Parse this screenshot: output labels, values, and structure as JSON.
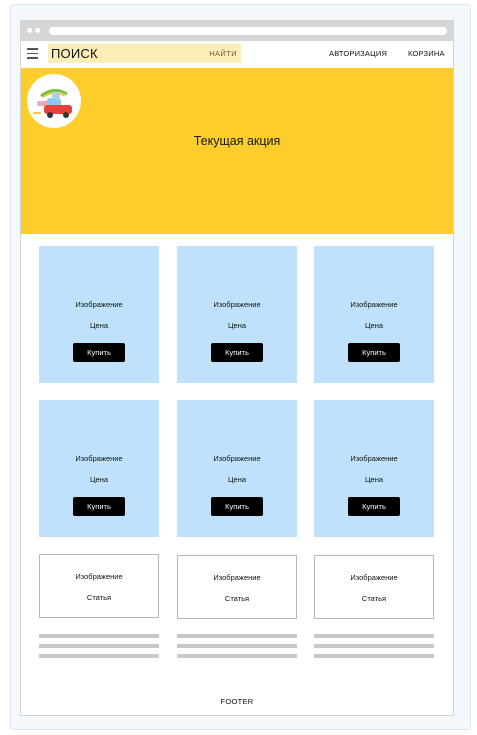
{
  "header": {
    "search_label": "ПОИСК",
    "search_button": "НАЙТИ",
    "nav_auth": "АВТОРИЗАЦИЯ",
    "nav_cart": "КОРЗИНА"
  },
  "banner": {
    "title": "Текущая акция",
    "background": "#fdcd2c"
  },
  "products": [
    {
      "image": "Изображение",
      "price": "Цена",
      "buy": "Купить"
    },
    {
      "image": "Изображение",
      "price": "Цена",
      "buy": "Купить"
    },
    {
      "image": "Изображение",
      "price": "Цена",
      "buy": "Купить"
    },
    {
      "image": "Изображение",
      "price": "Цена",
      "buy": "Купить"
    },
    {
      "image": "Изображение",
      "price": "Цена",
      "buy": "Купить"
    },
    {
      "image": "Изображение",
      "price": "Цена",
      "buy": "Купить"
    }
  ],
  "articles": [
    {
      "image": "Изображение",
      "label": "Статья"
    },
    {
      "image": "Изображение",
      "label": "Статья"
    },
    {
      "image": "Изображение",
      "label": "Статья"
    }
  ],
  "footer": {
    "text": "FOOTER"
  },
  "colors": {
    "product_card": "#bfe1fb",
    "search_bg": "#fdeeb8",
    "button": "#000000"
  }
}
